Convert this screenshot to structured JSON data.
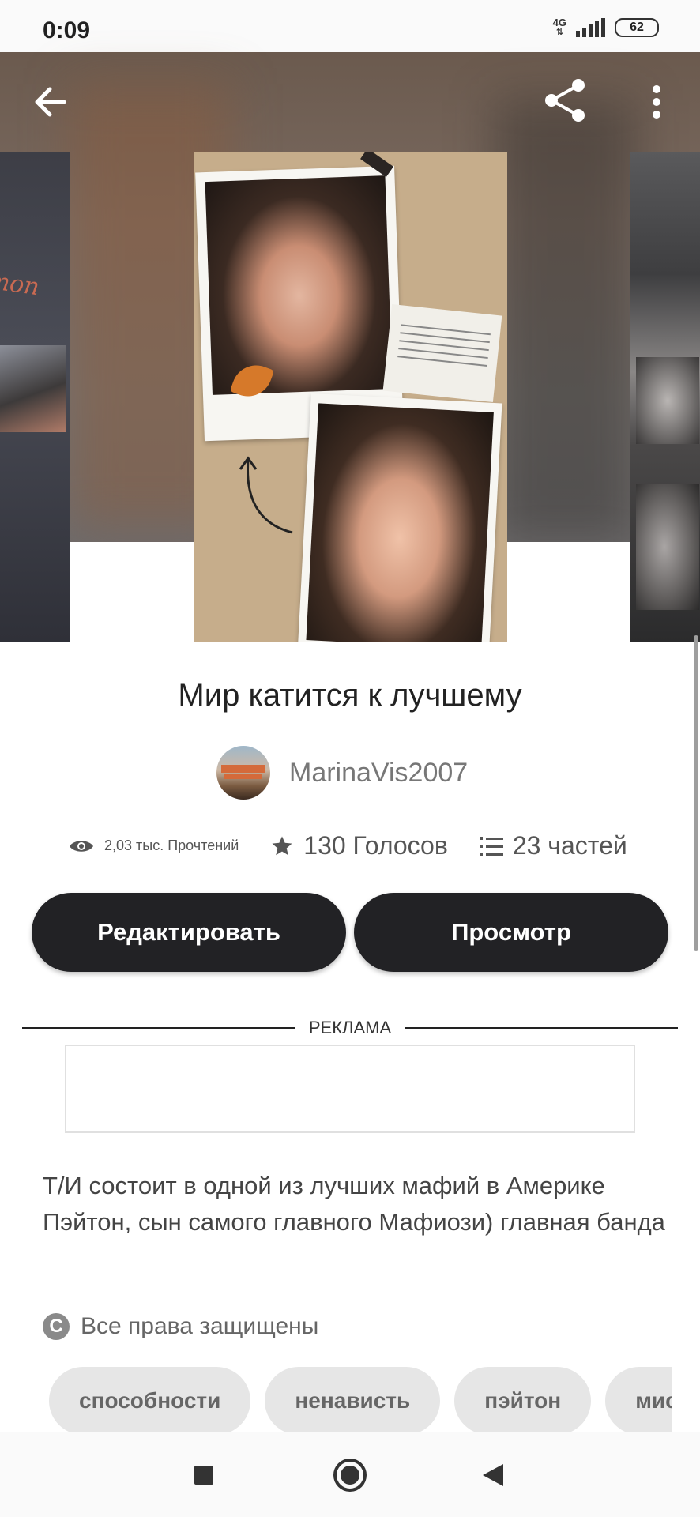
{
  "status_bar": {
    "time": "0:09",
    "network": "4G",
    "battery": "62"
  },
  "header": {
    "back_icon": "arrow-left-icon",
    "share_icon": "share-icon",
    "more_icon": "more-vertical-icon"
  },
  "story": {
    "title": "Мир катится к лучшему",
    "author": "MarinaVis2007",
    "reads": "2,03 тыс. Прочтений",
    "votes": "130 Голосов",
    "parts": "23 частей",
    "description": "Т/И состоит в одной из лучших мафий в Америке Пэйтон, сын самого главного Мафиози) главная банда",
    "rights": "Все права защищены",
    "tags": [
      "способности",
      "ненависть",
      "пэйтон",
      "мис"
    ]
  },
  "buttons": {
    "edit": "Редактировать",
    "preview": "Просмотр"
  },
  "ad": {
    "label": "РЕКЛАМА"
  },
  "covers": {
    "left_text": "mon"
  },
  "colors": {
    "button_bg": "#222225",
    "tag_bg": "#e6e6e6"
  }
}
